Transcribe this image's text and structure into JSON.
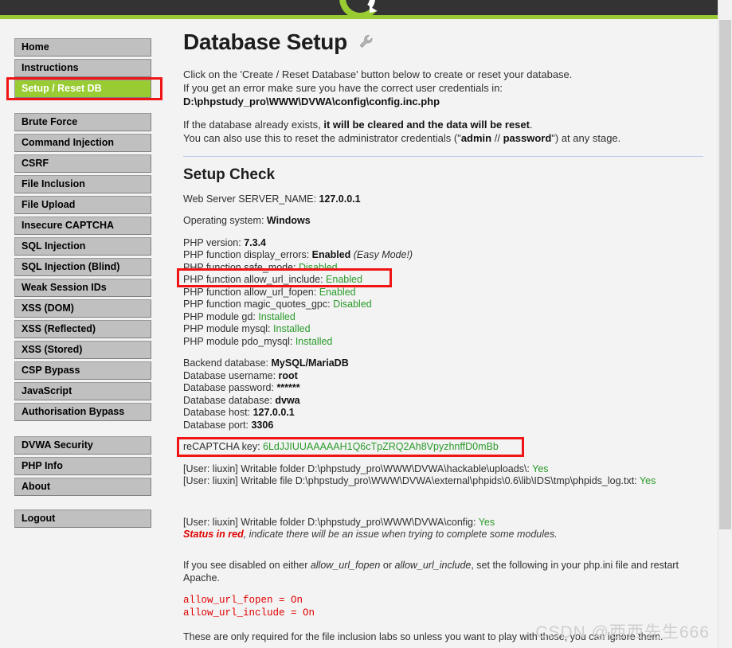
{
  "window": {
    "brand_green": "#99cc33",
    "header_bg": "#333333"
  },
  "sidebar": {
    "groups": [
      {
        "items": [
          {
            "label": "Home",
            "active": false
          },
          {
            "label": "Instructions",
            "active": false
          },
          {
            "label": "Setup / Reset DB",
            "active": true
          }
        ]
      },
      {
        "items": [
          {
            "label": "Brute Force",
            "active": false
          },
          {
            "label": "Command Injection",
            "active": false
          },
          {
            "label": "CSRF",
            "active": false
          },
          {
            "label": "File Inclusion",
            "active": false
          },
          {
            "label": "File Upload",
            "active": false
          },
          {
            "label": "Insecure CAPTCHA",
            "active": false
          },
          {
            "label": "SQL Injection",
            "active": false
          },
          {
            "label": "SQL Injection (Blind)",
            "active": false
          },
          {
            "label": "Weak Session IDs",
            "active": false
          },
          {
            "label": "XSS (DOM)",
            "active": false
          },
          {
            "label": "XSS (Reflected)",
            "active": false
          },
          {
            "label": "XSS (Stored)",
            "active": false
          },
          {
            "label": "CSP Bypass",
            "active": false
          },
          {
            "label": "JavaScript",
            "active": false
          },
          {
            "label": "Authorisation Bypass",
            "active": false
          }
        ]
      },
      {
        "items": [
          {
            "label": "DVWA Security",
            "active": false
          },
          {
            "label": "PHP Info",
            "active": false
          },
          {
            "label": "About",
            "active": false
          }
        ]
      },
      {
        "items": [
          {
            "label": "Logout",
            "active": false
          }
        ]
      }
    ]
  },
  "main": {
    "title": "Database Setup",
    "intro": {
      "line1": "Click on the 'Create / Reset Database' button below to create or reset your database.",
      "line2_prefix": "If you get an error make sure you have the correct user credentials in: ",
      "line2_path": "D:\\phpstudy_pro\\WWW\\DVWA\\config\\config.inc.php",
      "line3_prefix": "If the database already exists, ",
      "line3_bold": "it will be cleared and the data will be reset",
      "line3_suffix": ".",
      "line4_prefix": "You can also use this to reset the administrator credentials (\"",
      "line4_bold_a": "admin",
      "line4_mid": " // ",
      "line4_bold_b": "password",
      "line4_suffix": "\") at any stage."
    },
    "setup_check": {
      "heading": "Setup Check",
      "server_name_label": "Web Server SERVER_NAME: ",
      "server_name_value": "127.0.0.1",
      "os_label": "Operating system: ",
      "os_value": "Windows",
      "php_version_label": "PHP version: ",
      "php_version_value": "7.3.4",
      "display_errors_label": "PHP function display_errors: ",
      "display_errors_value": "Enabled",
      "display_errors_note": "(Easy Mode!)",
      "safe_mode_label": "PHP function safe_mode: ",
      "safe_mode_value": "Disabled",
      "allow_url_include_label": "PHP function allow_url_include: ",
      "allow_url_include_value": "Enabled",
      "allow_url_fopen_label": "PHP function allow_url_fopen: ",
      "allow_url_fopen_value": "Enabled",
      "magic_quotes_label": "PHP function magic_quotes_gpc: ",
      "magic_quotes_value": "Disabled",
      "module_gd_label": "PHP module gd: ",
      "module_gd_value": "Installed",
      "module_mysql_label": "PHP module mysql: ",
      "module_mysql_value": "Installed",
      "module_pdo_mysql_label": "PHP module pdo_mysql: ",
      "module_pdo_mysql_value": "Installed",
      "backend_db_label": "Backend database: ",
      "backend_db_value": "MySQL/MariaDB",
      "db_user_label": "Database username: ",
      "db_user_value": "root",
      "db_pass_label": "Database password: ",
      "db_pass_value": "******",
      "db_name_label": "Database database: ",
      "db_name_value": "dvwa",
      "db_host_label": "Database host: ",
      "db_host_value": "127.0.0.1",
      "db_port_label": "Database port: ",
      "db_port_value": "3306",
      "recaptcha_label": "reCAPTCHA key: ",
      "recaptcha_value": "6LdJJIUUAAAAAH1Q6cTpZRQ2Ah8VpyzhnffD0mBb",
      "writable_uploads_label": "[User: liuxin] Writable folder D:\\phpstudy_pro\\WWW\\DVWA\\hackable\\uploads\\: ",
      "writable_uploads_value": "Yes",
      "writable_phpids_label": "[User: liuxin] Writable file D:\\phpstudy_pro\\WWW\\DVWA\\external\\phpids\\0.6\\lib\\IDS\\tmp\\phpids_log.txt: ",
      "writable_phpids_value": "Yes",
      "writable_config_label": "[User: liuxin] Writable folder D:\\phpstudy_pro\\WWW\\DVWA\\config: ",
      "writable_config_value": "Yes",
      "status_red_bold": "Status in red",
      "status_red_rest": ", indicate there will be an issue when trying to complete some modules."
    },
    "footer_notes": {
      "disabled_note_a": "If you see disabled on either ",
      "disabled_note_fopen": "allow_url_fopen",
      "disabled_note_b": " or ",
      "disabled_note_include": "allow_url_include",
      "disabled_note_c": ", set the following in your php.ini file and restart Apache.",
      "ini_line1": "allow_url_fopen = On",
      "ini_line2": "allow_url_include = On",
      "tail_note": "These are only required for the file inclusion labs so unless you want to play with those, you can ignore them."
    }
  },
  "annotations": {
    "color": "#f01414",
    "boxes": [
      {
        "name": "setup-reset-db-nav"
      },
      {
        "name": "allow-url-include-line"
      },
      {
        "name": "recaptcha-key-line"
      }
    ]
  },
  "watermark": {
    "text": "CSDN @西西先生666"
  }
}
